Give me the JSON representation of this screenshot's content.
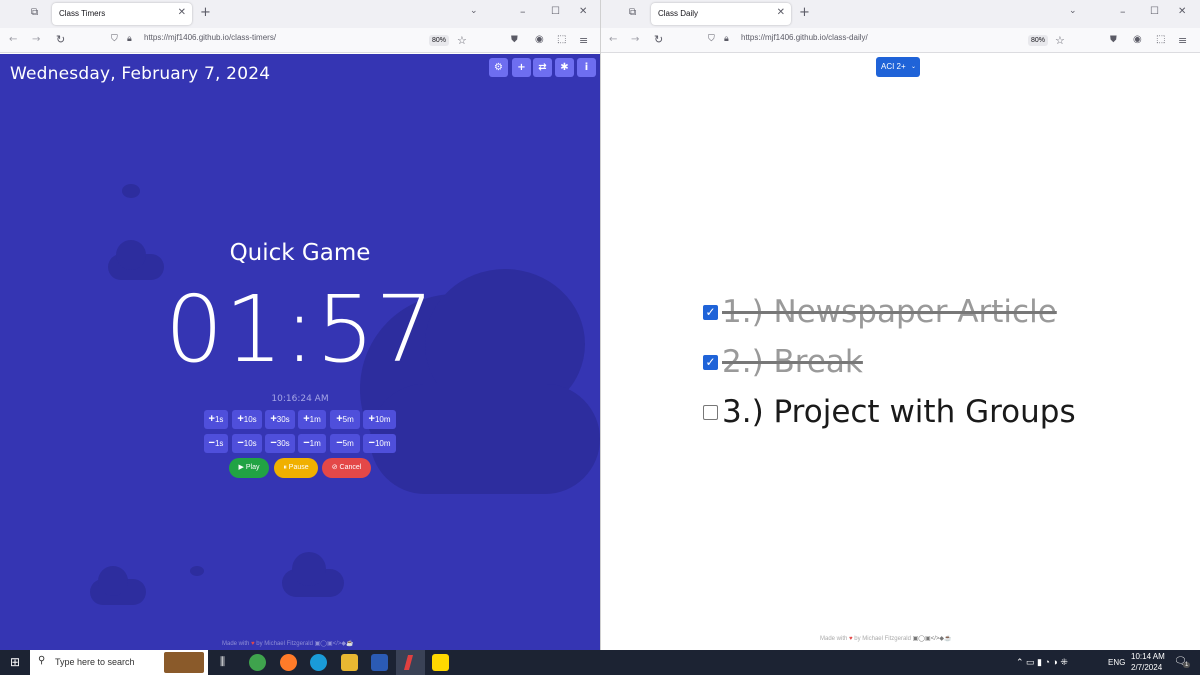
{
  "left_window": {
    "tab_title": "Class Timers",
    "url": "https://mjf1406.github.io/class-timers/",
    "zoom": "80%",
    "date": "Wednesday, February 7, 2024",
    "timer_title": "Quick Game",
    "timer_value": "01:57",
    "clock": "10:16:24 AM",
    "plus_buttons": [
      "1s",
      "10s",
      "30s",
      "1m",
      "5m",
      "10m"
    ],
    "minus_buttons": [
      "1s",
      "10s",
      "30s",
      "1m",
      "5m",
      "10m"
    ],
    "play_label": "Play",
    "pause_label": "Pause",
    "cancel_label": "Cancel",
    "footer": "Made with",
    "footer_by": "by Michael Fitzgerald"
  },
  "right_window": {
    "tab_title": "Class Daily",
    "url": "https://mjf1406.github.io/class-daily/",
    "zoom": "80%",
    "class_selector": "ACI 2+",
    "tasks": [
      {
        "label": "1.) Newspaper Article",
        "done": true
      },
      {
        "label": "2.) Break",
        "done": true
      },
      {
        "label": "3.) Project with Groups",
        "done": false
      }
    ],
    "footer": "Made with",
    "footer_by": "by Michael Fitzgerald"
  },
  "taskbar": {
    "search_placeholder": "Type here to search",
    "language": "ENG",
    "time": "10:14 AM",
    "date": "2/7/2024",
    "notification_count": "1"
  },
  "colors": {
    "timer_bg": "#3535b3",
    "accent_blue": "#1f63d8",
    "play": "#21a344",
    "pause": "#f0b000",
    "cancel": "#e44848"
  }
}
